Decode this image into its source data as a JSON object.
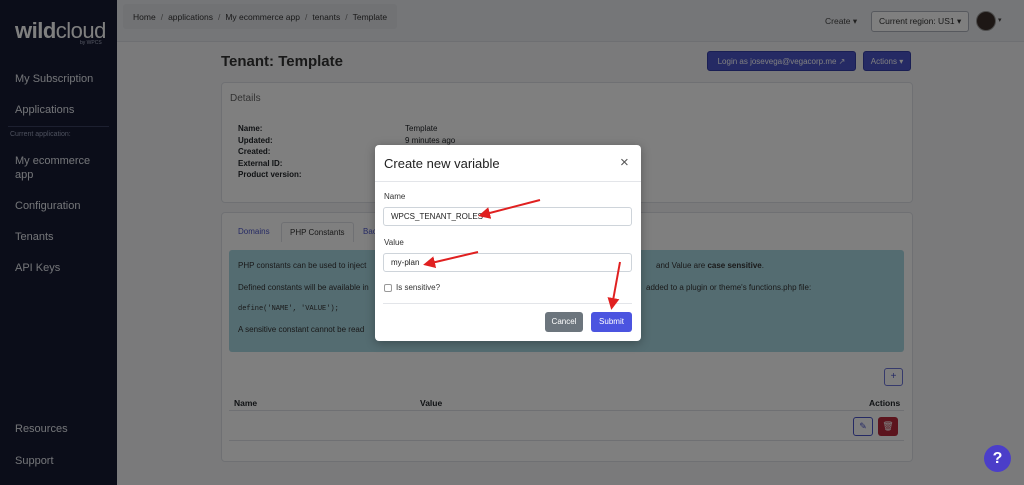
{
  "sidebar": {
    "logo_bold": "wild",
    "logo_light": "cloud",
    "logo_sub": "by WPCS",
    "items": [
      {
        "label": "My Subscription"
      },
      {
        "label": "Applications"
      },
      {
        "label": "My ecommerce app"
      },
      {
        "label": "Configuration"
      },
      {
        "label": "Tenants"
      },
      {
        "label": "API Keys"
      },
      {
        "label": "Resources"
      },
      {
        "label": "Support"
      }
    ],
    "caption": "Current application:"
  },
  "topbar": {
    "breadcrumb": [
      "Home",
      "applications",
      "My ecommerce app",
      "tenants",
      "Template"
    ],
    "create_label": "Create ▾",
    "region_label": "Current region: US1 ▾"
  },
  "page": {
    "title": "Tenant: Template",
    "login_label": "Login as josevega@vegacorp.me ↗",
    "actions_label": "Actions ▾"
  },
  "details": {
    "title": "Details",
    "labels": [
      "Name:",
      "Updated:",
      "Created:",
      "External ID:",
      "Product version:"
    ],
    "values": [
      "Template",
      "9 minutes ago"
    ]
  },
  "tabs": {
    "domains": "Domains",
    "php": "PHP Constants",
    "bac": "Bac"
  },
  "info": {
    "line1_a": "PHP constants can be used to inject",
    "line1_b": "and Value are ",
    "line1_bold": "case sensitive",
    "line1_end": ".",
    "line2_a": "Defined constants will be available in",
    "line2_b": "added to a plugin or theme's functions.php file:",
    "code": "define('NAME', 'VALUE');",
    "line4": "A sensitive constant cannot be read"
  },
  "table": {
    "plus": "+",
    "headers": {
      "name": "Name",
      "value": "Value",
      "actions": "Actions"
    }
  },
  "modal": {
    "title": "Create new variable",
    "close": "×",
    "name_label": "Name",
    "name_value": "WPCS_TENANT_ROLES",
    "value_label": "Value",
    "value_value": "my-plan",
    "sensitive_label": "Is sensitive?",
    "cancel": "Cancel",
    "submit": "Submit"
  },
  "help": "?",
  "colors": {
    "sidebar": "#161b33",
    "primary": "#4b54c9",
    "danger": "#b8283a",
    "info": "#a9d8e3",
    "arrow": "#e02020"
  }
}
